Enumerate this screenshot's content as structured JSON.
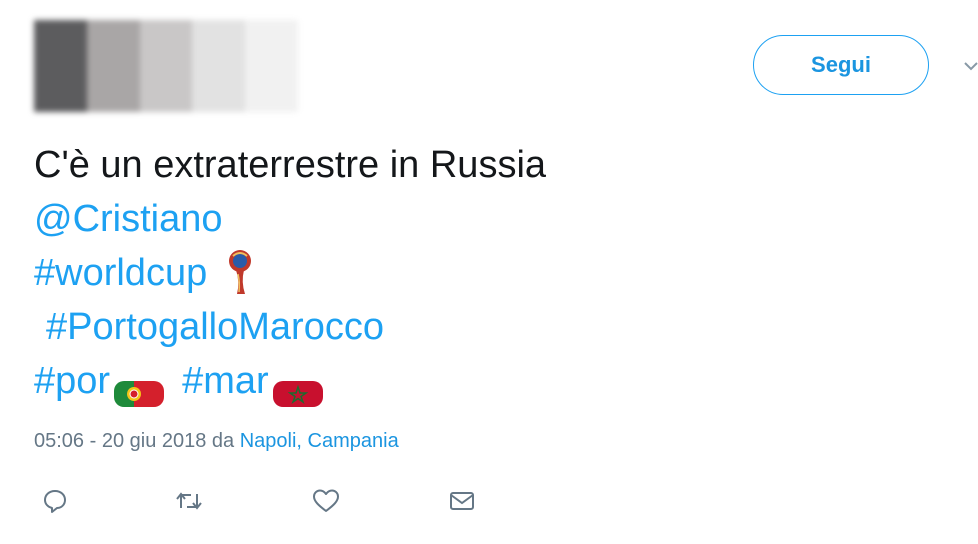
{
  "header": {
    "follow_label": "Segui"
  },
  "tweet": {
    "text_line1": "C'è un extraterrestre in Russia",
    "mention": "@Cristiano",
    "hashtag_worldcup": "#worldcup",
    "hashtag_match": "#PortogalloMarocco",
    "hashtag_por": "#por",
    "hashtag_mar": "#mar"
  },
  "meta": {
    "timestamp": "05:06 - 20 giu 2018 da ",
    "location": "Napoli, Campania"
  },
  "icons": {
    "reply": "reply-icon",
    "retweet": "retweet-icon",
    "like": "heart-icon",
    "dm": "envelope-icon",
    "caret": "chevron-down-icon"
  },
  "colors": {
    "link": "#1da1f2",
    "meta": "#657786",
    "text": "#14171a"
  }
}
